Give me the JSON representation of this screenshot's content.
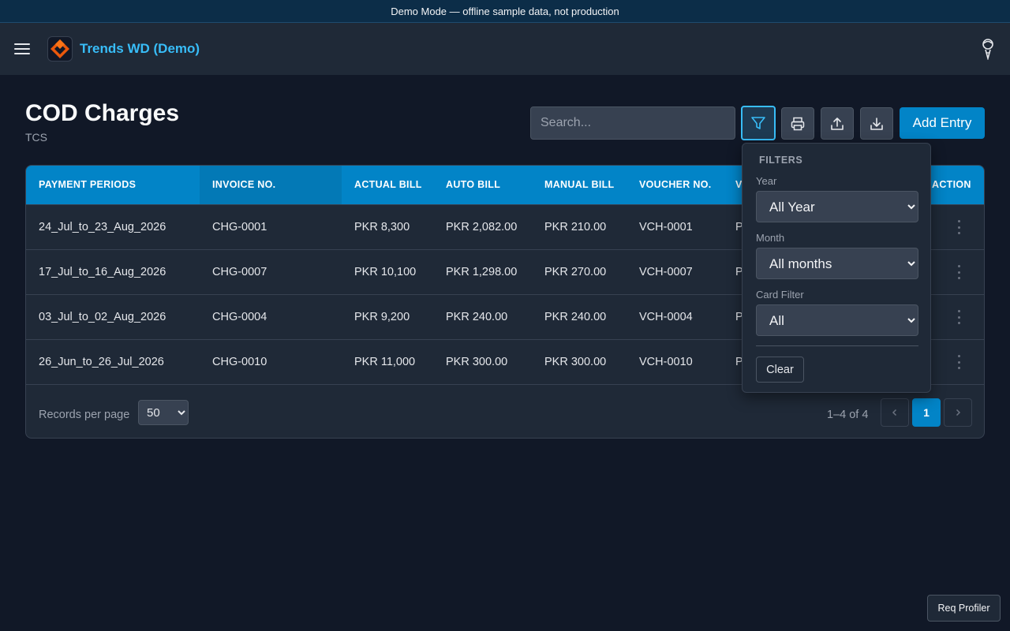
{
  "banner": {
    "text": "Demo Mode — offline sample data, not production"
  },
  "header": {
    "brand": "Trends WD (Demo)"
  },
  "page": {
    "title": "COD Charges",
    "subtitle": "TCS"
  },
  "toolbar": {
    "search_placeholder": "Search...",
    "add_label": "Add Entry"
  },
  "table": {
    "columns": [
      "PAYMENT PERIODS",
      "INVOICE NO.",
      "ACTUAL BILL",
      "AUTO BILL",
      "MANUAL BILL",
      "VOUCHER NO.",
      "V",
      "ACTION"
    ],
    "rows": [
      [
        "24_Jul_to_23_Aug_2026",
        "CHG-0001",
        "PKR 8,300",
        "PKR 2,082.00",
        "PKR 210.00",
        "VCH-0001",
        "P"
      ],
      [
        "17_Jul_to_16_Aug_2026",
        "CHG-0007",
        "PKR 10,100",
        "PKR 1,298.00",
        "PKR 270.00",
        "VCH-0007",
        "P"
      ],
      [
        "03_Jul_to_02_Aug_2026",
        "CHG-0004",
        "PKR 9,200",
        "PKR 240.00",
        "PKR 240.00",
        "VCH-0004",
        "P"
      ],
      [
        "26_Jun_to_26_Jul_2026",
        "CHG-0010",
        "PKR 11,000",
        "PKR 300.00",
        "PKR 300.00",
        "VCH-0010",
        "P"
      ]
    ]
  },
  "pagination": {
    "records_label": "Records per page",
    "per_page": "50",
    "range": "1–4 of 4",
    "current_page": "1"
  },
  "filters": {
    "title": "FILTERS",
    "year_label": "Year",
    "year_value": "All Year",
    "month_label": "Month",
    "month_value": "All months",
    "card_label": "Card Filter",
    "card_value": "All",
    "clear_label": "Clear"
  },
  "req_profiler": "Req Profiler",
  "colors": {
    "accent": "#0284c7",
    "brand_text": "#38bdf8",
    "background": "#111827",
    "surface": "#1f2937"
  }
}
